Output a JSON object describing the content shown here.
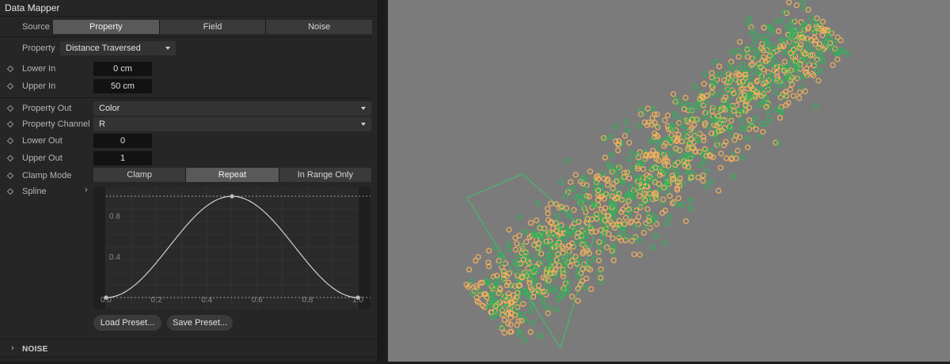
{
  "panel": {
    "title": "Data Mapper",
    "source": {
      "label": "Source",
      "tabs": [
        "Property",
        "Field",
        "Noise"
      ],
      "active": "Property"
    },
    "property": {
      "label": "Property",
      "value": "Distance Traversed"
    },
    "lower_in": {
      "label": "Lower In",
      "value": "0 cm"
    },
    "upper_in": {
      "label": "Upper In",
      "value": "50 cm"
    },
    "property_out": {
      "label": "Property Out",
      "value": "Color"
    },
    "property_channel": {
      "label": "Property Channel",
      "value": "R"
    },
    "lower_out": {
      "label": "Lower Out",
      "value": "0"
    },
    "upper_out": {
      "label": "Upper Out",
      "value": "1"
    },
    "clamp_mode": {
      "label": "Clamp Mode",
      "options": [
        "Clamp",
        "Repeat",
        "In Range Only"
      ],
      "active": "Repeat"
    },
    "spline": {
      "label": "Spline",
      "x_ticks": [
        "0.0",
        "0.2",
        "0.4",
        "0.6",
        "0.8",
        "1.0"
      ],
      "y_ticks": [
        "0.4",
        "0.8"
      ],
      "points": [
        [
          0,
          0
        ],
        [
          0.5,
          1
        ],
        [
          1,
          0
        ]
      ]
    },
    "buttons": {
      "load": "Load Preset...",
      "save": "Save Preset..."
    },
    "noise_section": "NOISE"
  },
  "viewport": {
    "background": "#7b7b7b",
    "particle_colors": [
      "#f2b25c",
      "#2fb45a"
    ]
  },
  "icons": {
    "keyframe": "diamond-icon",
    "expand": "chevron-right-icon"
  }
}
